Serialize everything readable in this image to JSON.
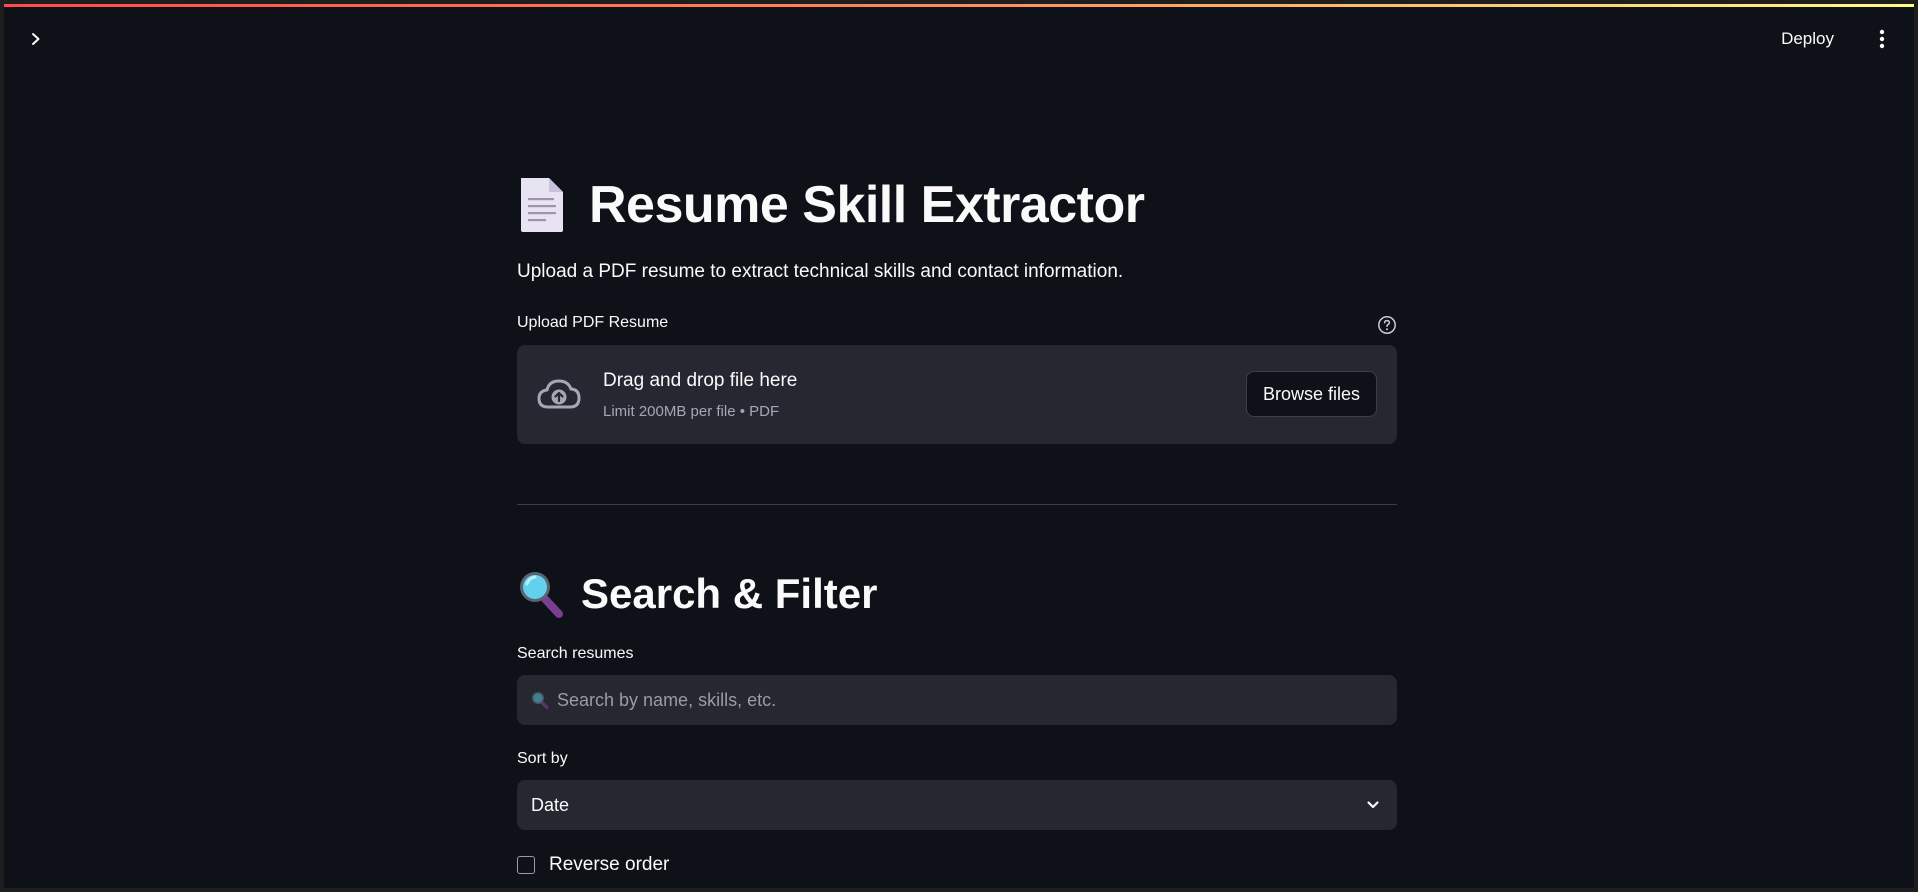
{
  "header": {
    "deploy_label": "Deploy",
    "sidebar_toggle_icon": "chevron-right-icon",
    "menu_icon": "vertical-dots-icon"
  },
  "colors": {
    "background": "#0e1117",
    "surface": "#262730",
    "accent_gradient_start": "#ff4b4b",
    "accent_gradient_end": "#fffd80",
    "muted_text": "#a3a8b8"
  },
  "main": {
    "title": "Resume Skill Extractor",
    "title_icon": "document-icon",
    "subtitle": "Upload a PDF resume to extract technical skills and contact information.",
    "uploader": {
      "label": "Upload PDF Resume",
      "help_icon": "question-circle-icon",
      "drop_title": "Drag and drop file here",
      "drop_sub": "Limit 200MB per file • PDF",
      "browse_label": "Browse files",
      "icon": "cloud-upload-icon"
    },
    "search_section": {
      "heading": "Search & Filter",
      "heading_icon": "magnifier-icon",
      "search_label": "Search resumes",
      "search_placeholder": "Search by name, skills, etc.",
      "search_value": "",
      "sort_label": "Sort by",
      "sort_value": "Date",
      "reverse_label": "Reverse order",
      "reverse_checked": false
    }
  }
}
